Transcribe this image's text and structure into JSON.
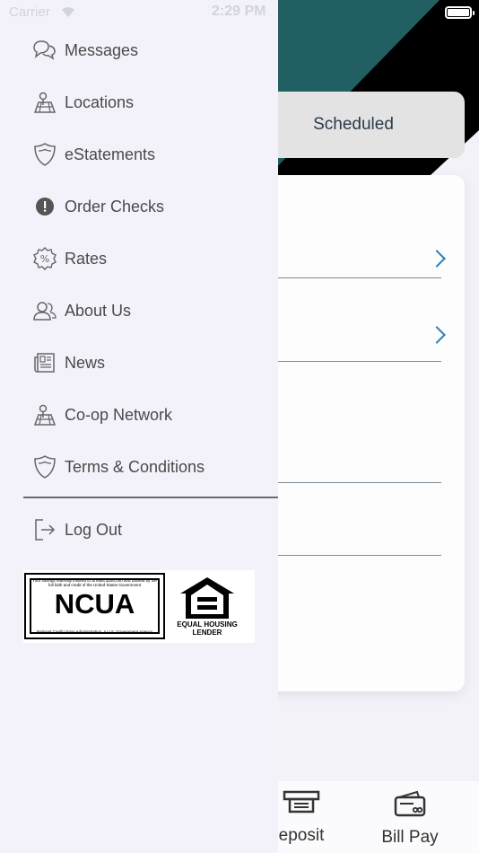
{
  "status_bar": {
    "carrier": "Carrier",
    "time": "2:29 PM"
  },
  "background": {
    "tab_label": "Scheduled",
    "bottom_nav": [
      {
        "label": "eposit",
        "icon": "deposit-icon"
      },
      {
        "label": "Bill Pay",
        "icon": "bill-pay-icon"
      }
    ]
  },
  "menu": {
    "items": [
      {
        "label": "Messages",
        "icon": "messages-icon"
      },
      {
        "label": "Locations",
        "icon": "locations-icon"
      },
      {
        "label": "eStatements",
        "icon": "shield-icon"
      },
      {
        "label": "Order Checks",
        "icon": "alert-icon"
      },
      {
        "label": "Rates",
        "icon": "rates-icon"
      },
      {
        "label": "About Us",
        "icon": "about-icon"
      },
      {
        "label": "News",
        "icon": "news-icon"
      },
      {
        "label": "Co-op Network",
        "icon": "locations-icon"
      },
      {
        "label": "Terms & Conditions",
        "icon": "shield-icon"
      }
    ],
    "logout": {
      "label": "Log Out",
      "icon": "logout-icon"
    }
  },
  "logos": {
    "ncua_top": "Your savings federally insured to at least $250,000 and backed by the full faith and credit of the United States Government",
    "ncua_name": "NCUA",
    "ncua_bottom": "National Credit Union Administration, a U.S. Government Agency",
    "ehl_line1": "EQUAL HOUSING",
    "ehl_line2": "LENDER"
  },
  "colors": {
    "accent": "#2b7fb3",
    "header_teal": "#225f62",
    "drawer_bg": "#f3f2fb"
  }
}
